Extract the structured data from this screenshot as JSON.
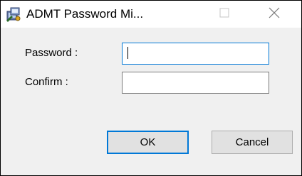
{
  "window": {
    "title": "ADMT Password Mi...",
    "controls": {
      "maximize_icon": "maximize-icon",
      "close_icon": "close-icon"
    }
  },
  "form": {
    "password_label": "Password :",
    "password_value": "",
    "confirm_label": "Confirm :",
    "confirm_value": ""
  },
  "buttons": {
    "ok_label": "OK",
    "cancel_label": "Cancel"
  },
  "colors": {
    "accent": "#0078d7",
    "window_bg": "#f0f0f0",
    "titlebar_bg": "#ffffff"
  }
}
